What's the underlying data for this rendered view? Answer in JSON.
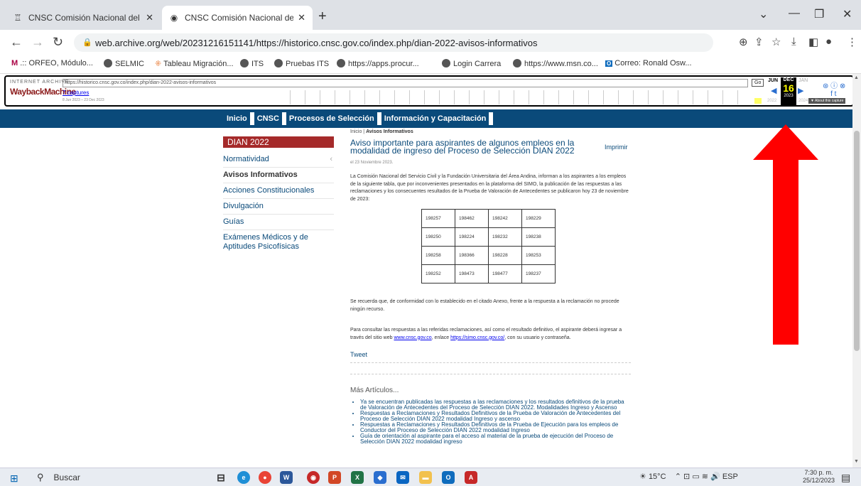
{
  "browser": {
    "tabs": [
      {
        "title": "CNSC Comisión Nacional del Se",
        "favicon": "wayback-icon",
        "active": false
      },
      {
        "title": "CNSC Comisión Nacional del Se",
        "favicon": "globe-icon",
        "active": true
      }
    ],
    "url": "web.archive.org/web/20231216151141/https://historico.cnsc.gov.co/index.php/dian-2022-avisos-informativos",
    "bookmarks": [
      ".:: ORFEO, Módulo...",
      "SELMIC",
      "Tableau Migración...",
      "ITS",
      "Pruebas ITS",
      "https://apps.procur...",
      "Login Carrera",
      "https://www.msn.co...",
      "Correo: Ronald Osw..."
    ]
  },
  "wayback": {
    "logo_top": "INTERNET ARCHIVE",
    "logo": "WaybackMachine",
    "url": "https://historico.cnsc.gov.co/index.php/dian-2022-avisos-informativos",
    "captures": "7 captures",
    "range": "8 Jun 2023 – 23 Dec 2023",
    "go": "Go",
    "months": [
      "JUN",
      "DEC",
      "JAN"
    ],
    "day": "16",
    "years": [
      "2022",
      "2023",
      "2024"
    ],
    "about": "▼ About this capture"
  },
  "site": {
    "nav": [
      "Inicio",
      "CNSC",
      "Procesos de Selección",
      "Información y Capacitación"
    ],
    "sidebar_title": "DIAN 2022",
    "sidebar": [
      "Normatividad",
      "Avisos Informativos",
      "Acciones Constitucionales",
      "Divulgación",
      "Guías",
      "Exámenes Médicos y de Aptitudes Psicofísicas"
    ],
    "breadcrumb_home": "Inicio",
    "breadcrumb_sep": "|",
    "breadcrumb_current": "Avisos Informativos",
    "title": "Aviso importante para aspirantes de algunos empleos en la modalidad de ingreso del Proceso de Selección DIAN 2022",
    "print": "Imprimir",
    "date": "el 23 Noviembre 2023.",
    "p1": "La Comisión Nacional del Servicio Civil y la Fundación Universitaria del Área Andina, informan a los aspirantes a los empleos de la siguiente tabla, que por inconvenientes presentados en la plataforma del SIMO, la publicación de las respuestas a las reclamaciones y los consecuentes resultados de la Prueba de Valoración de Antecedentes se publicaron hoy 23 de noviembre de 2023:",
    "codes": [
      [
        "198257",
        "198462",
        "198242",
        "198229"
      ],
      [
        "198250",
        "198224",
        "198232",
        "198238"
      ],
      [
        "198258",
        "198366",
        "198228",
        "198253"
      ],
      [
        "198252",
        "198473",
        "198477",
        "198237"
      ]
    ],
    "p2": "Se recuerda que, de conformidad con lo establecido en el citado Anexo, frente a la respuesta a la reclamación no procede ningún recurso.",
    "p3_a": "Para consultar las respuestas a las referidas reclamaciones, así como el resultado definitivo, el aspirante deberá ingresar a través del sitio web ",
    "p3_link1": "www.cnsc.gov.co",
    "p3_b": ", enlace ",
    "p3_link2": "https://simo.cnsc.gov.co/",
    "p3_c": ", con su usuario y contraseña.",
    "tweet": "Tweet",
    "more_title": "Más Artículos...",
    "more": [
      "Ya se encuentran publicadas las respuestas a las reclamaciones y los resultados definitivos de la prueba de Valoración de Antecedentes del Proceso de Selección DIAN 2022. Modalidades Ingreso y Ascenso",
      "Respuestas a Reclamaciones y Resultados Definitivos de la Prueba de Valoración de Antecedentes del Proceso de Selección DIAN 2022 modalidad Ingreso y ascenso",
      "Respuestas a Reclamaciones y Resultados Definitivos de la Prueba de Ejecución para los empleos de Conductor del Proceso de Selección DIAN 2022 modalidad Ingreso",
      "Guía de orientación al aspirante para el acceso al material de la prueba de ejecución del Proceso de Selección DIAN 2022 modalidad ingreso"
    ]
  },
  "taskbar": {
    "search": "Buscar",
    "weather": "15°C",
    "lang": "ESP",
    "time": "7:30 p. m.",
    "date": "25/12/2023"
  },
  "colors": {
    "nav_bg": "#0a4a7a",
    "sidebar_head": "#a52a2a",
    "arrow": "#ff0000"
  }
}
